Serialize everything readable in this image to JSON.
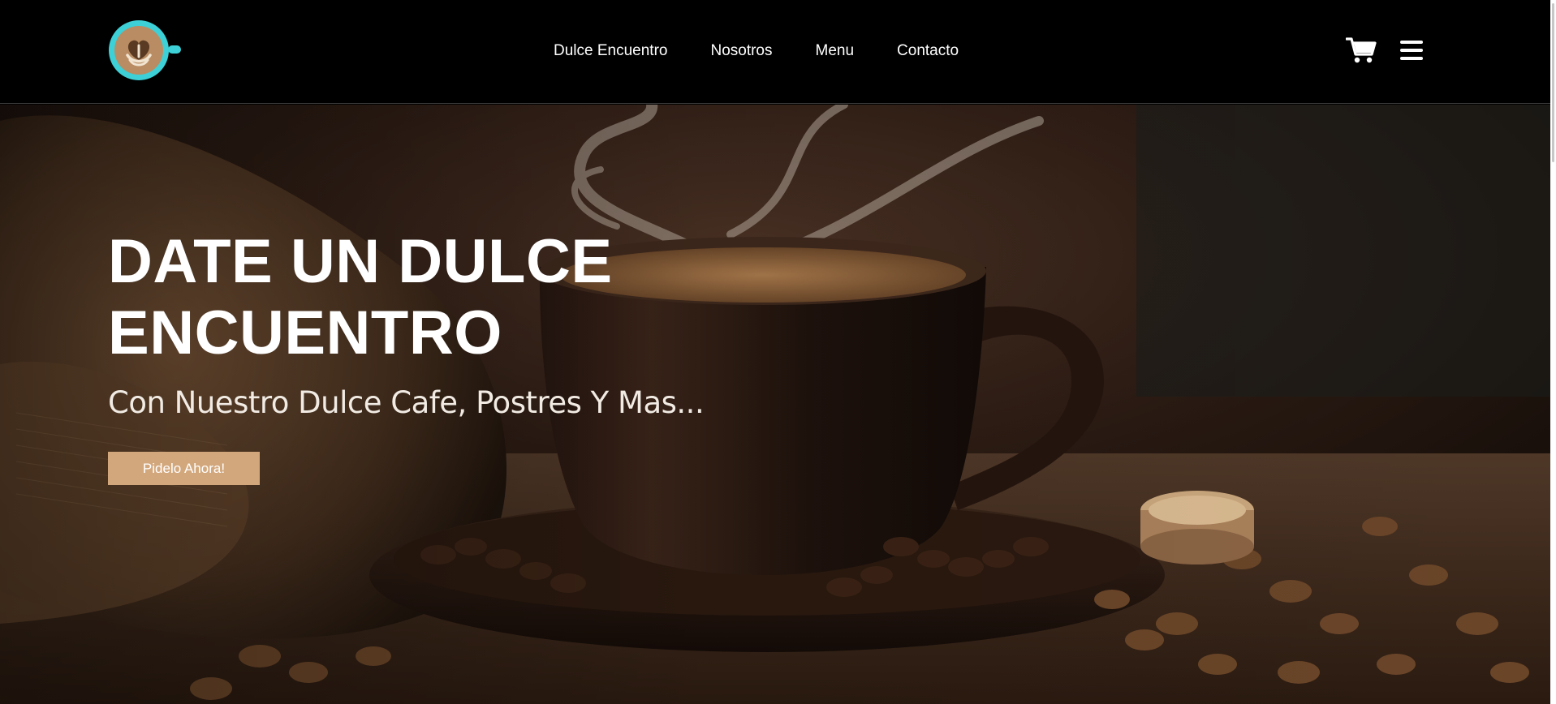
{
  "header": {
    "logo_name": "latte-art-cup-logo",
    "nav": [
      {
        "label": "Dulce Encuentro"
      },
      {
        "label": "Nosotros"
      },
      {
        "label": "Menu"
      },
      {
        "label": "Contacto"
      }
    ],
    "cart_icon": "cart-icon",
    "menu_icon": "hamburger-menu-icon"
  },
  "hero": {
    "title_line1": "DATE UN DULCE",
    "title_line2": "ENCUENTRO",
    "subtitle": "Con Nuestro Dulce Cafe, Postres Y Mas...",
    "cta_label": "Pidelo Ahora!"
  },
  "colors": {
    "header_bg": "#000000",
    "accent_cta": "#d3a77c",
    "logo_ring": "#3dd0d6",
    "logo_fill": "#b98c63"
  }
}
